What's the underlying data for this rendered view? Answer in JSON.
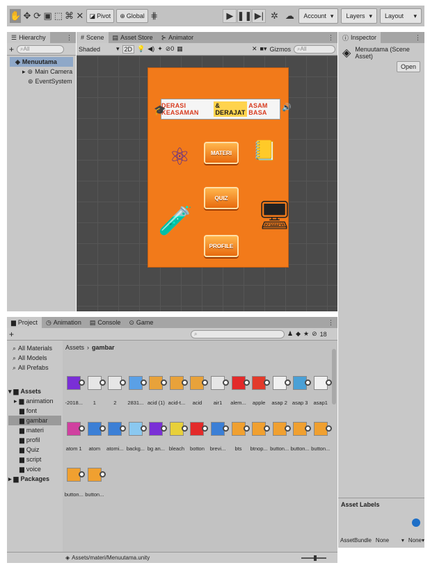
{
  "toolbar": {
    "pivot_label": "Pivot",
    "global_label": "Global",
    "account_label": "Account",
    "layers_label": "Layers",
    "layout_label": "Layout"
  },
  "hierarchy": {
    "tab_label": "Hierarchy",
    "add_label": "+",
    "search_placeholder": "All",
    "scene_name": "Menuutama",
    "items": [
      "Main Camera",
      "EventSystem"
    ]
  },
  "scene": {
    "tabs": [
      "Scene",
      "Asset Store",
      "Animator"
    ],
    "shading_mode": "Shaded",
    "mode_2d": "2D",
    "gizmos_label": "Gizmos",
    "search_placeholder": "All",
    "game": {
      "title_prefix": "DERASI KEASAMAN",
      "title_inner": "& DERAJAT",
      "title_suffix": "ASAM BASA",
      "buttons": [
        "MATERI",
        "QUIZ",
        "PROFILE"
      ]
    }
  },
  "inspector": {
    "tab_label": "Inspector",
    "asset_name": "Menuutama (Scene Asset)",
    "open_label": "Open",
    "asset_labels_heading": "Asset Labels",
    "assetbundle_label": "AssetBundle",
    "assetbundle_value": "None",
    "variant_value": "None"
  },
  "project": {
    "tabs": [
      "Project",
      "Animation",
      "Console",
      "Game"
    ],
    "add_label": "+",
    "hidden_count": "18",
    "favorites": [
      "All Materials",
      "All Models",
      "All Prefabs"
    ],
    "tree_root": "Assets",
    "folders": [
      "animation",
      "font",
      "gambar",
      "materi",
      "profil",
      "Quiz",
      "script",
      "voice"
    ],
    "packages_label": "Packages",
    "breadcrumb_root": "Assets",
    "breadcrumb_current": "gambar",
    "status_path": "Assets/materi/Menuutama.unity",
    "assets_row1": [
      "-2018...",
      "1",
      "2",
      "2831...",
      "acid (1)",
      "acid-t...",
      "acid",
      "air1",
      "alem...",
      "apple",
      "asap 2",
      "asap 3",
      "asap1",
      "atom 1"
    ],
    "assets_row2": [
      "atom",
      "atomi...",
      "backg...",
      "bg an...",
      "bleach",
      "botton",
      "brevi...",
      "bts",
      "btnop...",
      "button...",
      "button...",
      "button...",
      "button...",
      "button..."
    ]
  }
}
